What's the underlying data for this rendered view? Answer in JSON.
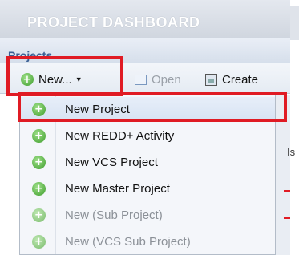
{
  "header": {
    "title": "PROJECT DASHBOARD"
  },
  "panel": {
    "title": "Projects"
  },
  "toolbar": {
    "new_label": "New...",
    "open_label": "Open",
    "create_label": "Create"
  },
  "menu": {
    "items": [
      {
        "label": "New Project",
        "enabled": true
      },
      {
        "label": "New REDD+ Activity",
        "enabled": true
      },
      {
        "label": "New VCS Project",
        "enabled": true
      },
      {
        "label": "New Master Project",
        "enabled": true
      },
      {
        "label": "New (Sub Project)",
        "enabled": false
      },
      {
        "label": "New (VCS Sub Project)",
        "enabled": false
      }
    ]
  },
  "background": {
    "partial_text": "Is"
  },
  "colors": {
    "highlight": "#e01b24",
    "header_text": "#ffffff",
    "panel_title": "#3a5f94"
  },
  "icons": {
    "menu_item": "plus-circle-icon",
    "open": "document-icon",
    "create": "save-icon"
  }
}
